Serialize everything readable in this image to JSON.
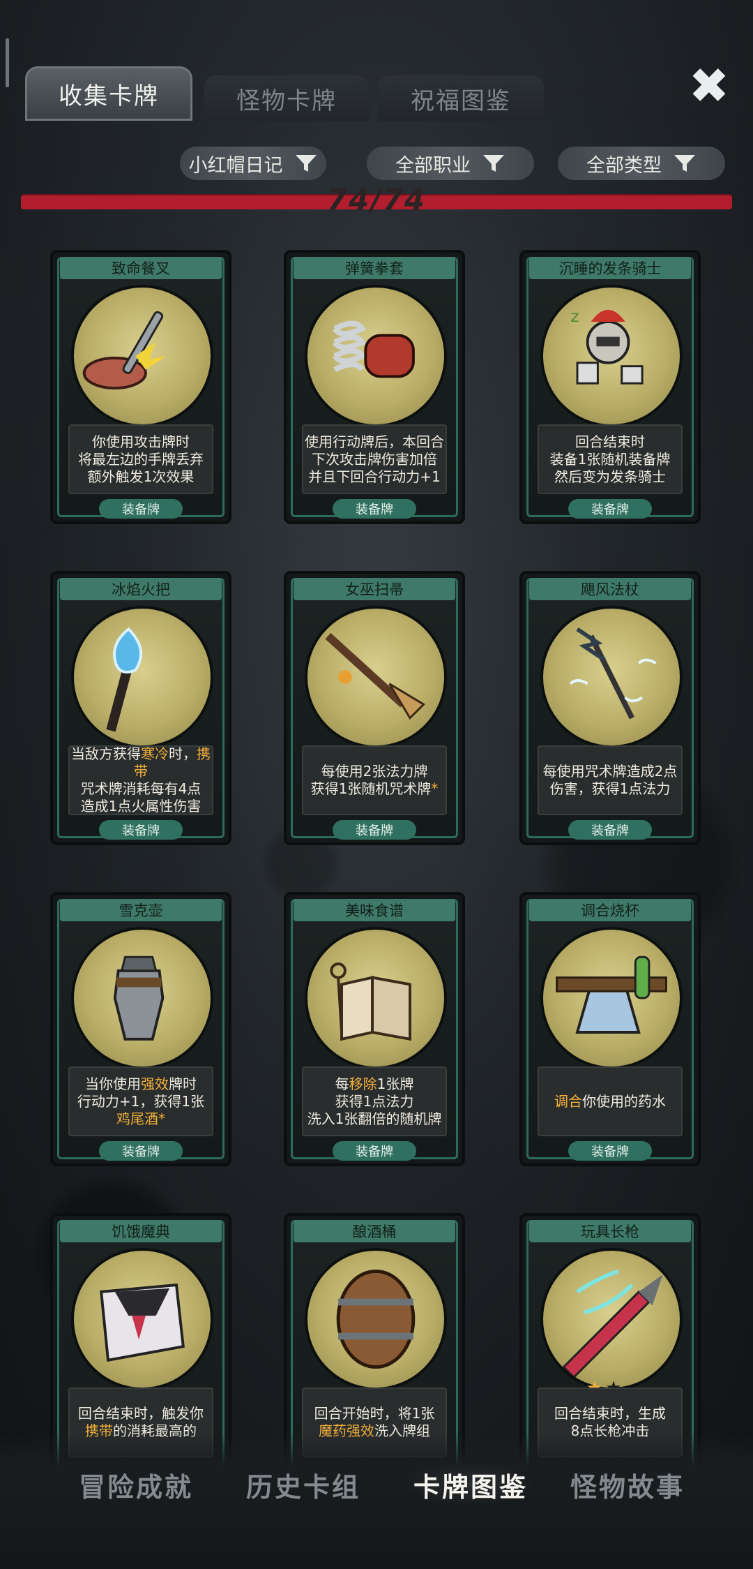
{
  "tabs": [
    "收集卡牌",
    "怪物卡牌",
    "祝福图鉴"
  ],
  "filters": [
    "小红帽日记",
    "全部职业",
    "全部类型"
  ],
  "progress": {
    "text": "74/74",
    "fraction": 1.0
  },
  "cards": [
    {
      "title": "致命餐叉",
      "lines": [
        [
          "你使用攻击牌时"
        ],
        [
          "将最左边的手牌丢弃"
        ],
        [
          "额外触发1次效果"
        ]
      ],
      "type": "装备牌",
      "icon": "fork-steak-icon"
    },
    {
      "title": "弹簧拳套",
      "lines": [
        [
          "使用行动牌后，本回合"
        ],
        [
          "下次攻击牌伤害加倍"
        ],
        [
          "并且下回合行动力+1"
        ]
      ],
      "type": "装备牌",
      "icon": "spring-glove-icon"
    },
    {
      "title": "沉睡的发条骑士",
      "lines": [
        [
          "回合结束时"
        ],
        [
          "装备1张随机装备牌"
        ],
        [
          "然后变为发条骑士"
        ]
      ],
      "type": "装备牌",
      "icon": "clockwork-knight-icon"
    },
    {
      "title": "冰焰火把",
      "lines": [
        [
          "当敌方获得",
          {
            "h": "寒冷"
          },
          "时，",
          {
            "h": "携带"
          }
        ],
        [
          "咒术牌消耗每有4点"
        ],
        [
          "造成1点火属性伤害"
        ]
      ],
      "type": "装备牌",
      "icon": "blue-torch-icon"
    },
    {
      "title": "女巫扫帚",
      "lines": [
        [
          "每使用2张法力牌"
        ],
        [
          "获得1张随机咒术牌",
          {
            "h": "*"
          }
        ]
      ],
      "type": "装备牌",
      "icon": "witch-broom-icon"
    },
    {
      "title": "飓风法杖",
      "lines": [
        [
          "每使用咒术牌造成2点"
        ],
        [
          "伤害，获得1点法力"
        ]
      ],
      "type": "装备牌",
      "icon": "storm-staff-icon"
    },
    {
      "title": "雪克壶",
      "lines": [
        [
          "当你使用",
          {
            "h": "强效"
          },
          "牌时"
        ],
        [
          "行动力+1，获得1张"
        ],
        [
          {
            "h": "鸡尾酒*"
          }
        ]
      ],
      "type": "装备牌",
      "icon": "shaker-icon"
    },
    {
      "title": "美味食谱",
      "lines": [
        [
          "每",
          {
            "h": "移除"
          },
          "1张牌"
        ],
        [
          "获得1点法力"
        ],
        [
          "洗入1张翻倍的随机牌"
        ]
      ],
      "type": "装备牌",
      "icon": "recipe-book-icon"
    },
    {
      "title": "调合烧杯",
      "lines": [
        [
          {
            "h": "调合"
          },
          "你使用的药水"
        ]
      ],
      "type": "装备牌",
      "icon": "beaker-belt-icon"
    },
    {
      "title": "饥饿魔典",
      "lines": [
        [
          "回合结束时，触发你"
        ],
        [
          {
            "h": "携带"
          },
          "的消耗最高的"
        ]
      ],
      "type": "",
      "icon": "hungry-grimoire-icon"
    },
    {
      "title": "酿酒桶",
      "lines": [
        [
          "回合开始时，将1张"
        ],
        [
          {
            "h": "魔药强效"
          },
          "洗入牌组"
        ]
      ],
      "type": "",
      "icon": "barrel-icon"
    },
    {
      "title": "玩具长枪",
      "lines": [
        [
          "回合结束时，生成"
        ],
        [
          "8点长枪冲击"
        ]
      ],
      "type": "",
      "icon": "toy-lance-icon",
      "stars": 1,
      "stars_max": 2
    }
  ],
  "bottom_nav": [
    "冒险成就",
    "历史卡组",
    "卡牌图鉴",
    "怪物故事"
  ],
  "active_bottom_index": 2,
  "colors": {
    "accent_red": "#b21e2d",
    "highlight": "#f2b03a",
    "card_green": "#3f7a68"
  }
}
